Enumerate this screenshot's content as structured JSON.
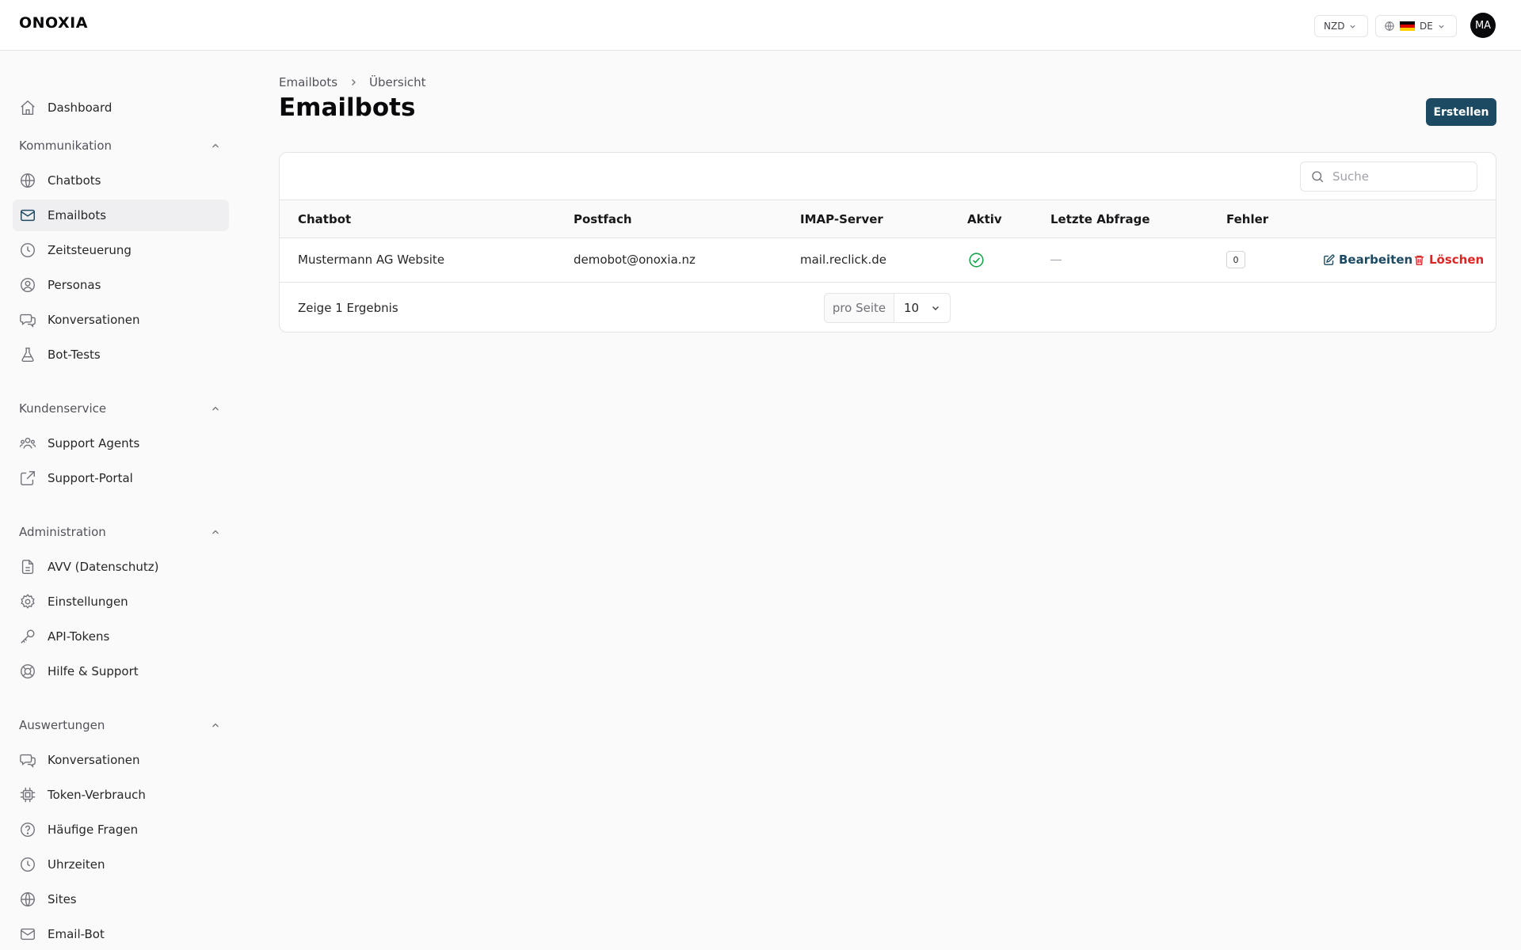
{
  "app": {
    "logo": "ONOXIA",
    "currency": "NZD",
    "language": "DE",
    "avatar_initials": "MA"
  },
  "sidebar": {
    "dashboard": "Dashboard",
    "sections": [
      {
        "title": "Kommunikation",
        "items": [
          {
            "label": "Chatbots",
            "icon": "globe-icon"
          },
          {
            "label": "Emailbots",
            "icon": "mail-icon",
            "active": true
          },
          {
            "label": "Zeitsteuerung",
            "icon": "clock-icon"
          },
          {
            "label": "Personas",
            "icon": "user-circle-icon"
          },
          {
            "label": "Konversationen",
            "icon": "chat-icon"
          },
          {
            "label": "Bot-Tests",
            "icon": "flask-icon"
          }
        ]
      },
      {
        "title": "Kundenservice",
        "items": [
          {
            "label": "Support Agents",
            "icon": "users-icon"
          },
          {
            "label": "Support-Portal",
            "icon": "external-link-icon"
          }
        ]
      },
      {
        "title": "Administration",
        "items": [
          {
            "label": "AVV (Datenschutz)",
            "icon": "document-icon"
          },
          {
            "label": "Einstellungen",
            "icon": "gear-icon"
          },
          {
            "label": "API-Tokens",
            "icon": "key-icon"
          },
          {
            "label": "Hilfe & Support",
            "icon": "lifebuoy-icon"
          }
        ]
      },
      {
        "title": "Auswertungen",
        "items": [
          {
            "label": "Konversationen",
            "icon": "chat-icon"
          },
          {
            "label": "Token-Verbrauch",
            "icon": "chip-icon"
          },
          {
            "label": "Häufige Fragen",
            "icon": "question-icon"
          },
          {
            "label": "Uhrzeiten",
            "icon": "clock-icon"
          },
          {
            "label": "Sites",
            "icon": "globe-icon"
          },
          {
            "label": "Email-Bot",
            "icon": "mail-icon"
          }
        ]
      }
    ]
  },
  "main": {
    "breadcrumb": [
      "Emailbots",
      "Übersicht"
    ],
    "title": "Emailbots",
    "create_label": "Erstellen",
    "search_placeholder": "Suche",
    "columns": [
      "Chatbot",
      "Postfach",
      "IMAP-Server",
      "Aktiv",
      "Letzte Abfrage",
      "Fehler"
    ],
    "rows": [
      {
        "chatbot": "Mustermann AG Website",
        "postfach": "demobot@onoxia.nz",
        "imap": "mail.reclick.de",
        "aktiv": true,
        "letzte_abfrage": "",
        "fehler": "0"
      }
    ],
    "edit_label": "Bearbeiten",
    "delete_label": "Löschen",
    "result_text": "Zeige 1 Ergebnis",
    "per_page_label": "pro Seite",
    "per_page_value": "10"
  },
  "colors": {
    "primary": "#1c4a63",
    "danger": "#dc2626",
    "success": "#16a34a",
    "active_bg": "#efeff1"
  }
}
